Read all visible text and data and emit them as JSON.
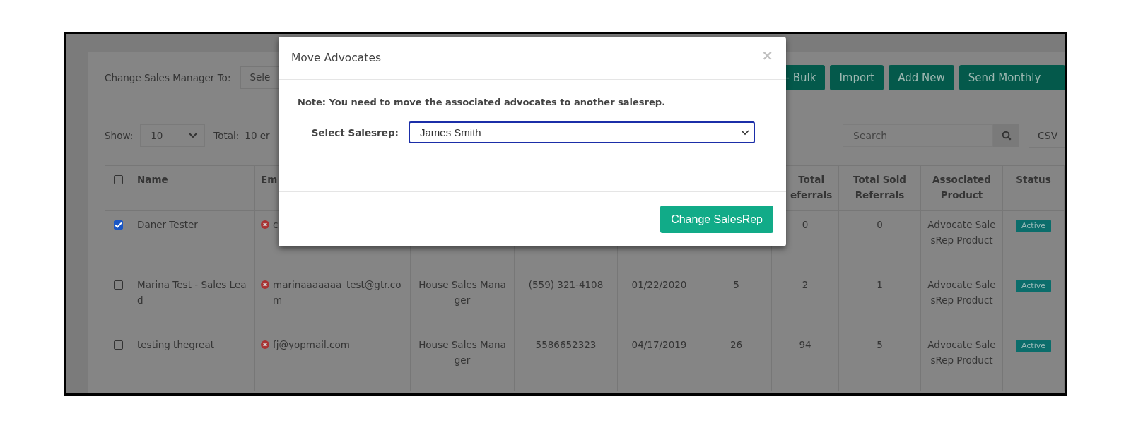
{
  "toolbar": {
    "label": "Change Sales Manager To:",
    "select_value": "Sele",
    "buttons": [
      "- Bulk",
      "Import",
      "Add New",
      "Send Monthly"
    ]
  },
  "list_controls": {
    "show_label": "Show:",
    "page_size": "10",
    "total_label": "Total:",
    "total_value": "10 er",
    "search": {
      "placeholder": "Search"
    },
    "export_button": "CSV"
  },
  "table": {
    "select_all": {
      "checked": false
    },
    "headers": {
      "name": "Name",
      "email": "Em",
      "total_referrals": "Total\neferrals",
      "total_sold_referrals": "Total Sold Referrals",
      "associated_product": "Associated Product",
      "status": "Status"
    },
    "rows": [
      {
        "checked": true,
        "name": "Daner Tester",
        "email_invalid": true,
        "email": "c",
        "total_referrals": "0",
        "total_sold_referrals": "0",
        "associated_product": "Advocate SalesRep Product",
        "status": "Active"
      },
      {
        "checked": false,
        "name": "Marina Test - Sales Lead",
        "email_invalid": true,
        "email": "marinaaaaaaa_test@gtr.com",
        "role": "House Sales Manager",
        "phone": "(559) 321-4108",
        "date": "01/22/2020",
        "column_7": "5",
        "total_referrals": "2",
        "total_sold_referrals": "1",
        "associated_product": "Advocate SalesRep Product",
        "status": "Active"
      },
      {
        "checked": false,
        "name": "testing thegreat",
        "email_invalid": true,
        "email": "fj@yopmail.com",
        "role": "House Sales Manager",
        "phone": "5586652323",
        "date": "04/17/2019",
        "column_7": "26",
        "total_referrals": "94",
        "total_sold_referrals": "5",
        "associated_product": "Advocate SalesRep Product",
        "status": "Active"
      }
    ]
  },
  "modal": {
    "title": "Move Advocates",
    "close": "×",
    "note": "Note: You need to move the associated advocates to another salesrep.",
    "field_label": "Select Salesrep:",
    "field_value": "James Smith",
    "submit": "Change SalesRep"
  }
}
